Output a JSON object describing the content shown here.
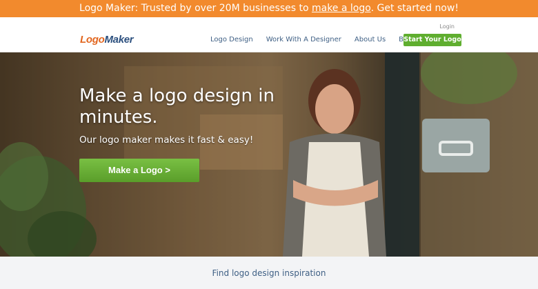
{
  "promo": {
    "prefix": "Logo Maker: Trusted by over 20M businesses to ",
    "link": "make a logo",
    "suffix": ". Get started now!"
  },
  "header": {
    "login": "Login",
    "logo_part1": "Logo",
    "logo_part2": "Maker",
    "nav": [
      "Logo Design",
      "Work With A Designer",
      "About Us",
      "Blog"
    ],
    "cta": "Start Your Logo"
  },
  "hero": {
    "title": "Make a logo design in minutes.",
    "subtitle": "Our logo maker makes it fast & easy!",
    "button": "Make a Logo >"
  },
  "footer_strip": {
    "link": "Find logo design inspiration"
  },
  "colors": {
    "promo_orange": "#f28a2d",
    "cta_green": "#5fae2f",
    "nav_blue": "#3e5f84"
  }
}
